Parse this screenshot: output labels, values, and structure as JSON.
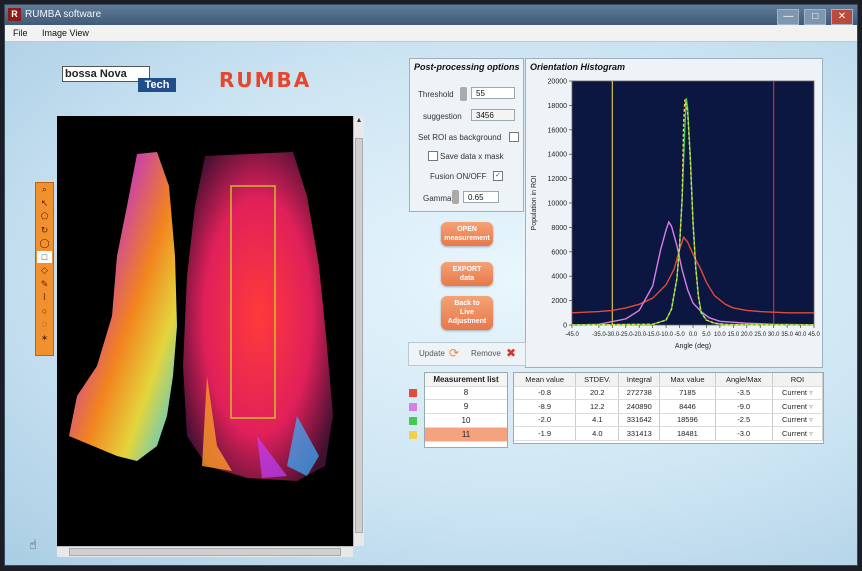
{
  "window": {
    "title": "RUMBA software",
    "controls": [
      "—",
      "□",
      "✕"
    ]
  },
  "menu": [
    "File",
    "Image View"
  ],
  "brand": {
    "company_part1": "bossa Nova",
    "company_part2": "Tech",
    "product": "RUMBA"
  },
  "toolbar": {
    "tools": [
      "magnifier-icon",
      "arrow-pointer-icon",
      "polygon-icon",
      "rotate-icon",
      "ellipse-icon",
      "rectangle-select-icon",
      "diamond-icon",
      "freehand-icon",
      "polyline-icon",
      "circle-icon",
      "lasso-icon",
      "star-icon"
    ],
    "glyphs": [
      "⌕",
      "↖",
      "⬠",
      "↻",
      "◯",
      "□",
      "◇",
      "✎",
      "⌇",
      "○",
      "◌",
      "✶"
    ],
    "selected_index": 5
  },
  "postprocessing": {
    "title": "Post-processing options",
    "threshold_label": "Threshold",
    "threshold_value": "55",
    "suggestion_label": "suggestion",
    "suggestion_value": "3456",
    "set_roi_label": "Set ROI as background",
    "set_roi_checked": false,
    "save_mask_label": "Save data x mask",
    "save_mask_checked": false,
    "fusion_label": "Fusion ON/OFF",
    "fusion_checked": true,
    "gamma_label": "Gamma",
    "gamma_value": "0.65"
  },
  "buttons": {
    "open_measurement": [
      "OPEN",
      "measurement"
    ],
    "export_data": [
      "EXPORT",
      "data"
    ],
    "back_live": [
      "Back to",
      "Live",
      "Adjustment"
    ]
  },
  "update_remove": {
    "update_label": "Update",
    "remove_label": "Remove"
  },
  "measurement_list": {
    "header": "Measurement list",
    "items": [
      {
        "label": "8",
        "color": "#e04b3a"
      },
      {
        "label": "9",
        "color": "#d77fe6"
      },
      {
        "label": "10",
        "color": "#44c84e"
      },
      {
        "label": "11",
        "color": "#f0d24a"
      }
    ],
    "selected_index": 3
  },
  "results": {
    "columns": [
      "Mean value",
      "STDEV.",
      "Integral",
      "Max value",
      "Angle/Max",
      "ROI"
    ],
    "rows": [
      [
        "-0.8",
        "20.2",
        "272738",
        "7185",
        "-3.5",
        "Current"
      ],
      [
        "-8.9",
        "12.2",
        "240890",
        "8446",
        "-9.0",
        "Current"
      ],
      [
        "-2.0",
        "4.1",
        "331642",
        "18596",
        "-2.5",
        "Current"
      ],
      [
        "-1.9",
        "4.0",
        "331413",
        "18481",
        "-3.0",
        "Current"
      ]
    ]
  },
  "chart_data": {
    "type": "line",
    "title": "Orientation Histogram",
    "xlabel": "Angle (deg)",
    "ylabel": "Population in ROI",
    "xlim": [
      -45,
      45
    ],
    "ylim": [
      0,
      20000
    ],
    "xticks": [
      "-45.0",
      "-35.0",
      "-30.0",
      "-25.0",
      "-20.0",
      "-15.0",
      "-10.0",
      "-5.0",
      "0.0",
      "5.0",
      "10.0",
      "15.0",
      "20.0",
      "25.0",
      "30.0",
      "35.0",
      "40.0",
      "45.0"
    ],
    "xtick_values": [
      -45,
      -35,
      -30,
      -25,
      -20,
      -15,
      -10,
      -5,
      0,
      5,
      10,
      15,
      20,
      25,
      30,
      35,
      40,
      45
    ],
    "yticks": [
      "0",
      "2000",
      "4000",
      "6000",
      "8000",
      "10000",
      "12000",
      "14000",
      "16000",
      "18000",
      "20000"
    ],
    "ytick_values": [
      0,
      2000,
      4000,
      6000,
      8000,
      10000,
      12000,
      14000,
      16000,
      18000,
      20000
    ],
    "grid": false,
    "background": "#0b1740",
    "vlines": [
      {
        "x": -30,
        "color": "#d9c43c"
      },
      {
        "x": 30,
        "color": "#c9312b"
      }
    ],
    "series": [
      {
        "color": "#e04b3a",
        "x": [
          -45,
          -40,
          -35,
          -30,
          -25,
          -20,
          -15,
          -10,
          -7,
          -5,
          -3.5,
          -2,
          0,
          3,
          5,
          8,
          12,
          15,
          20,
          25,
          30,
          35,
          40,
          45
        ],
        "y": [
          1000,
          1050,
          1100,
          1200,
          1400,
          1700,
          2200,
          3300,
          4600,
          6200,
          7185,
          6800,
          5800,
          4500,
          3500,
          2400,
          1700,
          1400,
          1200,
          1100,
          1050,
          1000,
          1000,
          1000
        ]
      },
      {
        "color": "#d77fe6",
        "x": [
          -45,
          -35,
          -25,
          -20,
          -15,
          -12,
          -10,
          -9,
          -8,
          -6,
          -4,
          -2,
          0,
          3,
          6,
          10,
          20,
          30,
          45
        ],
        "y": [
          0,
          60,
          500,
          1200,
          3200,
          6200,
          7800,
          8446,
          8100,
          6500,
          4500,
          2900,
          1800,
          1100,
          600,
          300,
          150,
          60,
          20
        ]
      },
      {
        "color": "#44c84e",
        "x": [
          -45,
          -15,
          -10,
          -8,
          -6,
          -5,
          -4,
          -3,
          -2.5,
          -2,
          -1,
          0,
          1,
          2,
          3,
          5,
          8,
          12,
          45
        ],
        "y": [
          0,
          60,
          400,
          1300,
          3800,
          6500,
          10500,
          16200,
          18596,
          17800,
          13800,
          8500,
          4800,
          2400,
          1100,
          400,
          150,
          40,
          0
        ]
      },
      {
        "color": "#f0d24a",
        "dashed": true,
        "x": [
          -45,
          -15,
          -10,
          -8,
          -6,
          -5,
          -4,
          -3.5,
          -3,
          -2,
          -1,
          0,
          1,
          2,
          3,
          5,
          8,
          12,
          45
        ],
        "y": [
          0,
          60,
          400,
          1300,
          3800,
          6500,
          10500,
          16500,
          18481,
          17500,
          13600,
          8400,
          4700,
          2300,
          1000,
          400,
          150,
          40,
          0
        ]
      }
    ]
  }
}
